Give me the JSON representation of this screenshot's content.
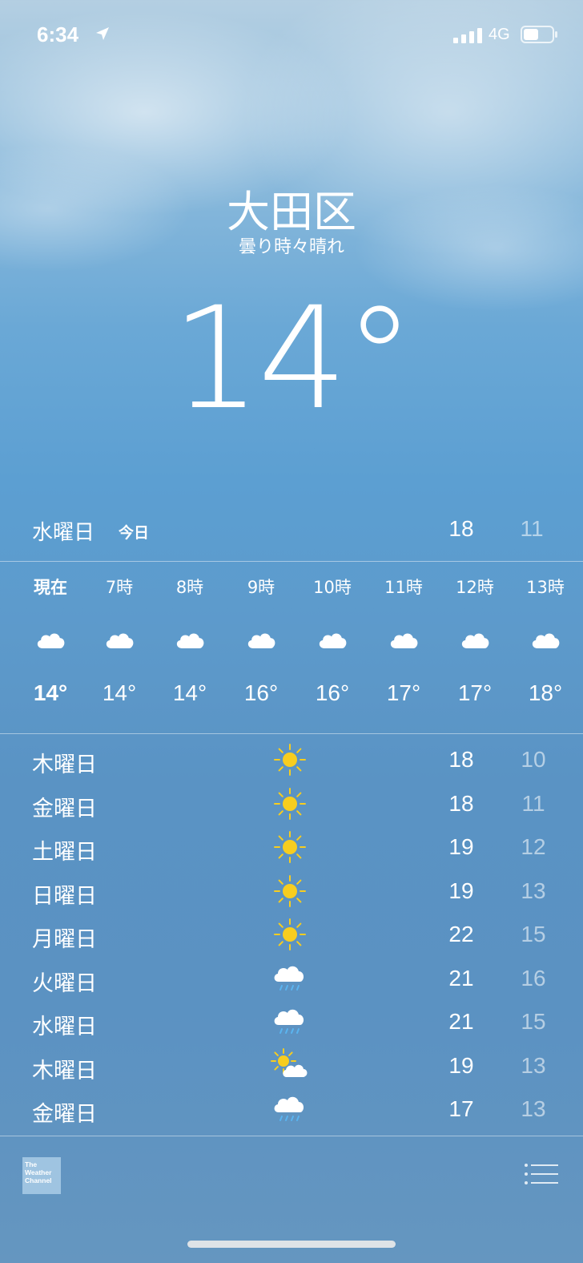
{
  "status": {
    "time": "6:34",
    "network": "4G"
  },
  "location": {
    "city": "大田区",
    "condition": "曇り時々晴れ",
    "current_temp": "14°"
  },
  "today": {
    "day": "水曜日",
    "tag": "今日",
    "high": "18",
    "low": "11"
  },
  "hourly": [
    {
      "label": "現在",
      "icon": "cloud-icon",
      "temp": "14°"
    },
    {
      "label": "7時",
      "icon": "cloud-icon",
      "temp": "14°"
    },
    {
      "label": "8時",
      "icon": "cloud-icon",
      "temp": "14°"
    },
    {
      "label": "9時",
      "icon": "cloud-icon",
      "temp": "16°"
    },
    {
      "label": "10時",
      "icon": "cloud-icon",
      "temp": "16°"
    },
    {
      "label": "11時",
      "icon": "cloud-icon",
      "temp": "17°"
    },
    {
      "label": "12時",
      "icon": "cloud-icon",
      "temp": "17°"
    },
    {
      "label": "13時",
      "icon": "cloud-icon",
      "temp": "18°"
    }
  ],
  "daily": [
    {
      "day": "木曜日",
      "icon": "sun",
      "high": "18",
      "low": "10"
    },
    {
      "day": "金曜日",
      "icon": "sun",
      "high": "18",
      "low": "11"
    },
    {
      "day": "土曜日",
      "icon": "sun",
      "high": "19",
      "low": "12"
    },
    {
      "day": "日曜日",
      "icon": "sun",
      "high": "19",
      "low": "13"
    },
    {
      "day": "月曜日",
      "icon": "sun",
      "high": "22",
      "low": "15"
    },
    {
      "day": "火曜日",
      "icon": "rain",
      "high": "21",
      "low": "16"
    },
    {
      "day": "水曜日",
      "icon": "rain",
      "high": "21",
      "low": "15"
    },
    {
      "day": "木曜日",
      "icon": "partly-cloudy",
      "high": "19",
      "low": "13"
    },
    {
      "day": "金曜日",
      "icon": "rain",
      "high": "17",
      "low": "13"
    }
  ],
  "footer": {
    "logo_lines": [
      "The",
      "Weather",
      "Channel"
    ]
  },
  "colors": {
    "sun": "#f7cd1f",
    "rain": "#5ab4f0",
    "low_temp": "rgba(255,255,255,0.55)"
  }
}
